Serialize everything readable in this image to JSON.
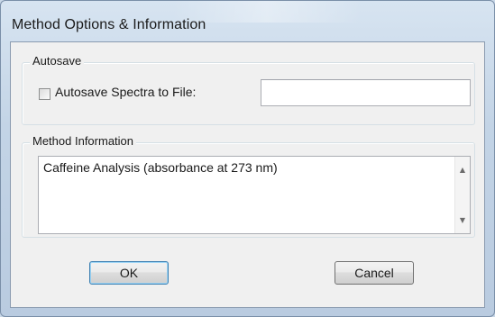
{
  "window": {
    "title": "Method Options & Information"
  },
  "autosave": {
    "legend": "Autosave",
    "checkbox_label": "Autosave Spectra to File:",
    "checked": false,
    "file_path": ""
  },
  "method_info": {
    "legend": "Method Information",
    "text": "Caffeine Analysis (absorbance at 273 nm)"
  },
  "buttons": {
    "ok": "OK",
    "cancel": "Cancel"
  },
  "colors": {
    "frame": "#c3d4e6",
    "client": "#f0f0f0",
    "default_border": "#3c7fb1"
  }
}
